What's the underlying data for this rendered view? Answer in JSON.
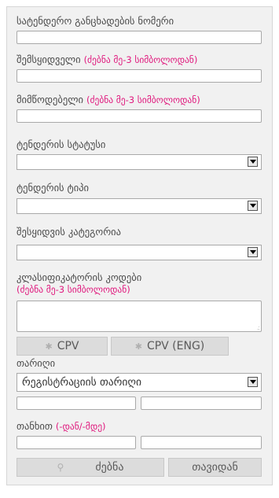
{
  "form": {
    "tender_number_label": "სატენდერო განცხადების ნომერი",
    "buyer_label": "შემსყიდველი",
    "buyer_hint": "(ძებნა მე-3 სიმბოლოდან)",
    "supplier_label": "მიმწოდებელი",
    "supplier_hint": "(ძებნა მე-3 სიმბოლოდან)",
    "status_label": "ტენდერის სტატუსი",
    "status_value": "",
    "type_label": "ტენდერის ტიპი",
    "type_value": "",
    "category_label": "შესყიდვის კატეგორია",
    "category_value": "",
    "codes_label": "კლასიფიკატორის კოდები",
    "codes_hint": "(ძებნა მე-3 სიმბოლოდან)",
    "cpv_button": "CPV",
    "cpv_eng_button": "CPV (ENG)",
    "date_label": "თარიღი",
    "date_type_value": "რეგისტრაციის თარიღი",
    "amount_label": "თანხით",
    "amount_hint": "(-დან/-მდე)",
    "search_button": "ძებნა",
    "reset_button": "თავიდან"
  }
}
